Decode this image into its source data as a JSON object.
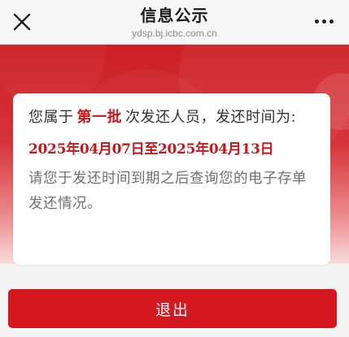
{
  "navbar": {
    "title": "信息公示",
    "subtitle": "ydsp.bj.icbc.com.cn",
    "close_icon": "close-icon",
    "more_icon": "more-icon"
  },
  "notice": {
    "text_before_batch": "您属于",
    "batch": "第一批",
    "text_after_batch": "次发还人员，发还时间为:",
    "date_range": "2025年04月07日至2025年04月13日",
    "hint": "请您于发还时间到期之后查询您的电子存单发还情况。"
  },
  "exit_button": {
    "label": "退出"
  },
  "colors": {
    "brand_red": "#c9161c",
    "button_red": "#d3181f",
    "hero_red": "#cc1f24"
  }
}
